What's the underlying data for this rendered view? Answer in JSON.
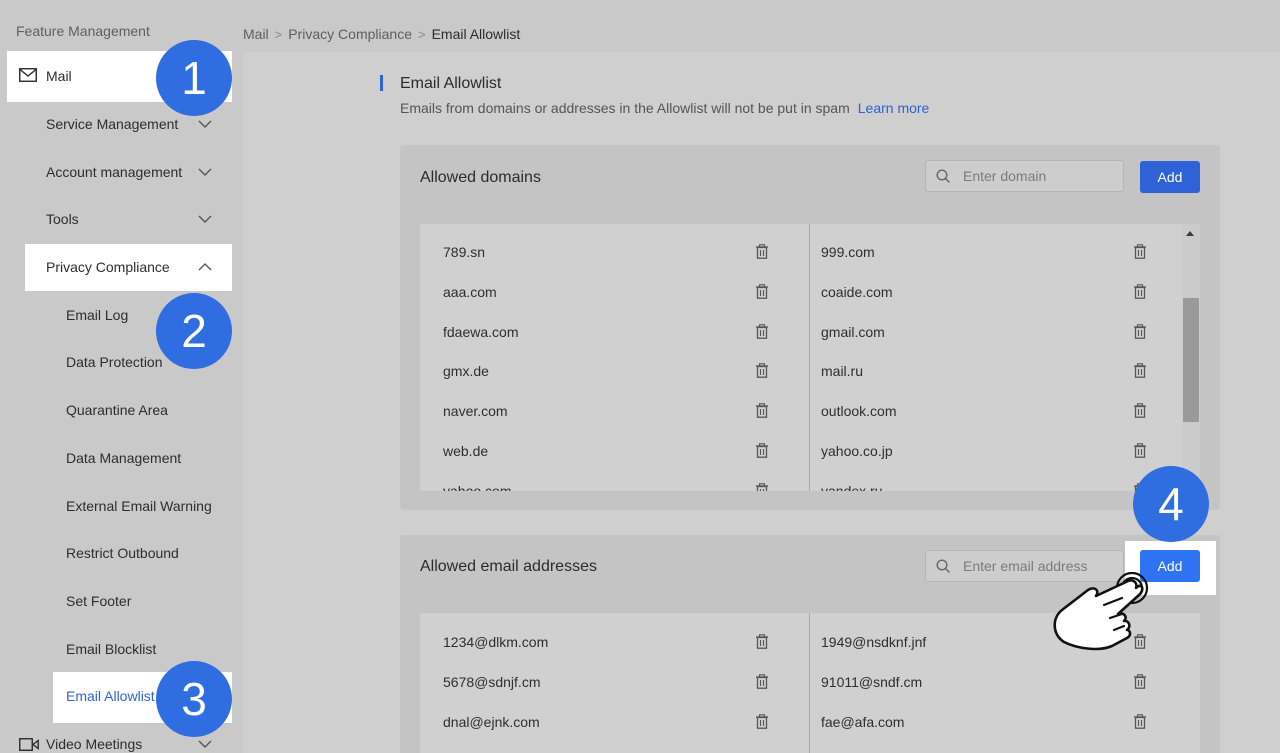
{
  "sidebar": {
    "heading": "Feature Management",
    "mail_label": "Mail",
    "items": [
      {
        "label": "Service Management"
      },
      {
        "label": "Account management"
      },
      {
        "label": "Tools"
      },
      {
        "label": "Privacy Compliance"
      }
    ],
    "sub_items": [
      {
        "label": "Email Log"
      },
      {
        "label": "Data Protection"
      },
      {
        "label": "Quarantine Area"
      },
      {
        "label": "Data Management"
      },
      {
        "label": "External Email Warning"
      },
      {
        "label": "Restrict Outbound"
      },
      {
        "label": "Set Footer"
      },
      {
        "label": "Email Blocklist"
      },
      {
        "label": "Email Allowlist"
      }
    ],
    "video_label": "Video Meetings"
  },
  "badges": {
    "one": "1",
    "two": "2",
    "three": "3",
    "four": "4"
  },
  "breadcrumb": {
    "items": [
      "Mail",
      "Privacy Compliance"
    ],
    "current": "Email Allowlist"
  },
  "section": {
    "title": "Email Allowlist",
    "description": "Emails from domains or addresses in the Allowlist will not be put in spam",
    "learn_more": "Learn more"
  },
  "domains_card": {
    "title": "Allowed domains",
    "placeholder": "Enter domain",
    "add_label": "Add",
    "left": [
      "789.sn",
      "aaa.com",
      "fdaewa.com",
      "gmx.de",
      "naver.com",
      "web.de",
      "yahoo.com"
    ],
    "right": [
      "999.com",
      "coaide.com",
      "gmail.com",
      "mail.ru",
      "outlook.com",
      "yahoo.co.jp",
      "yandex.ru"
    ]
  },
  "emails_card": {
    "title": "Allowed email addresses",
    "placeholder": "Enter email address",
    "add_label": "Add",
    "left": [
      "1234@dlkm.com",
      "5678@sdnjf.cm",
      "dnal@ejnk.com"
    ],
    "right": [
      "1949@nsdknf.jnf",
      "91011@sndf.cm",
      "fae@afa.com"
    ]
  },
  "colors": {
    "accent": "#2f62d6",
    "badge": "#2f6de0",
    "active_link": "#2f62d6"
  }
}
